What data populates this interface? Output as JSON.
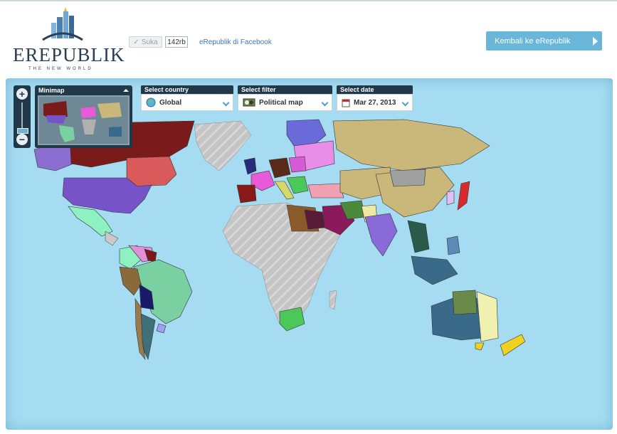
{
  "header": {
    "logo_text": "EREPUBLIK",
    "logo_tagline": "THE NEW WORLD",
    "like_label": "Suka",
    "like_count": "142rb",
    "facebook_link": "eRepublik di Facebook",
    "back_button": "Kembali ke eRepublik"
  },
  "map_controls": {
    "minimap_title": "Minimap",
    "country": {
      "label": "Select country",
      "value": "Global"
    },
    "filter": {
      "label": "Select filter",
      "value": "Political map"
    },
    "date": {
      "label": "Select date",
      "value": "Mar 27, 2013"
    }
  },
  "colors": {
    "ocean": "#a6dcf2",
    "unclaimed": "#c9c9c9",
    "panel": "#203847",
    "accent": "#69b6d8"
  },
  "icons": [
    "building-logo-icon",
    "checkmark-icon",
    "zoom-in-icon",
    "zoom-out-icon",
    "globe-icon",
    "political-map-icon",
    "calendar-icon",
    "chevron-down-icon",
    "arrow-right-icon"
  ]
}
